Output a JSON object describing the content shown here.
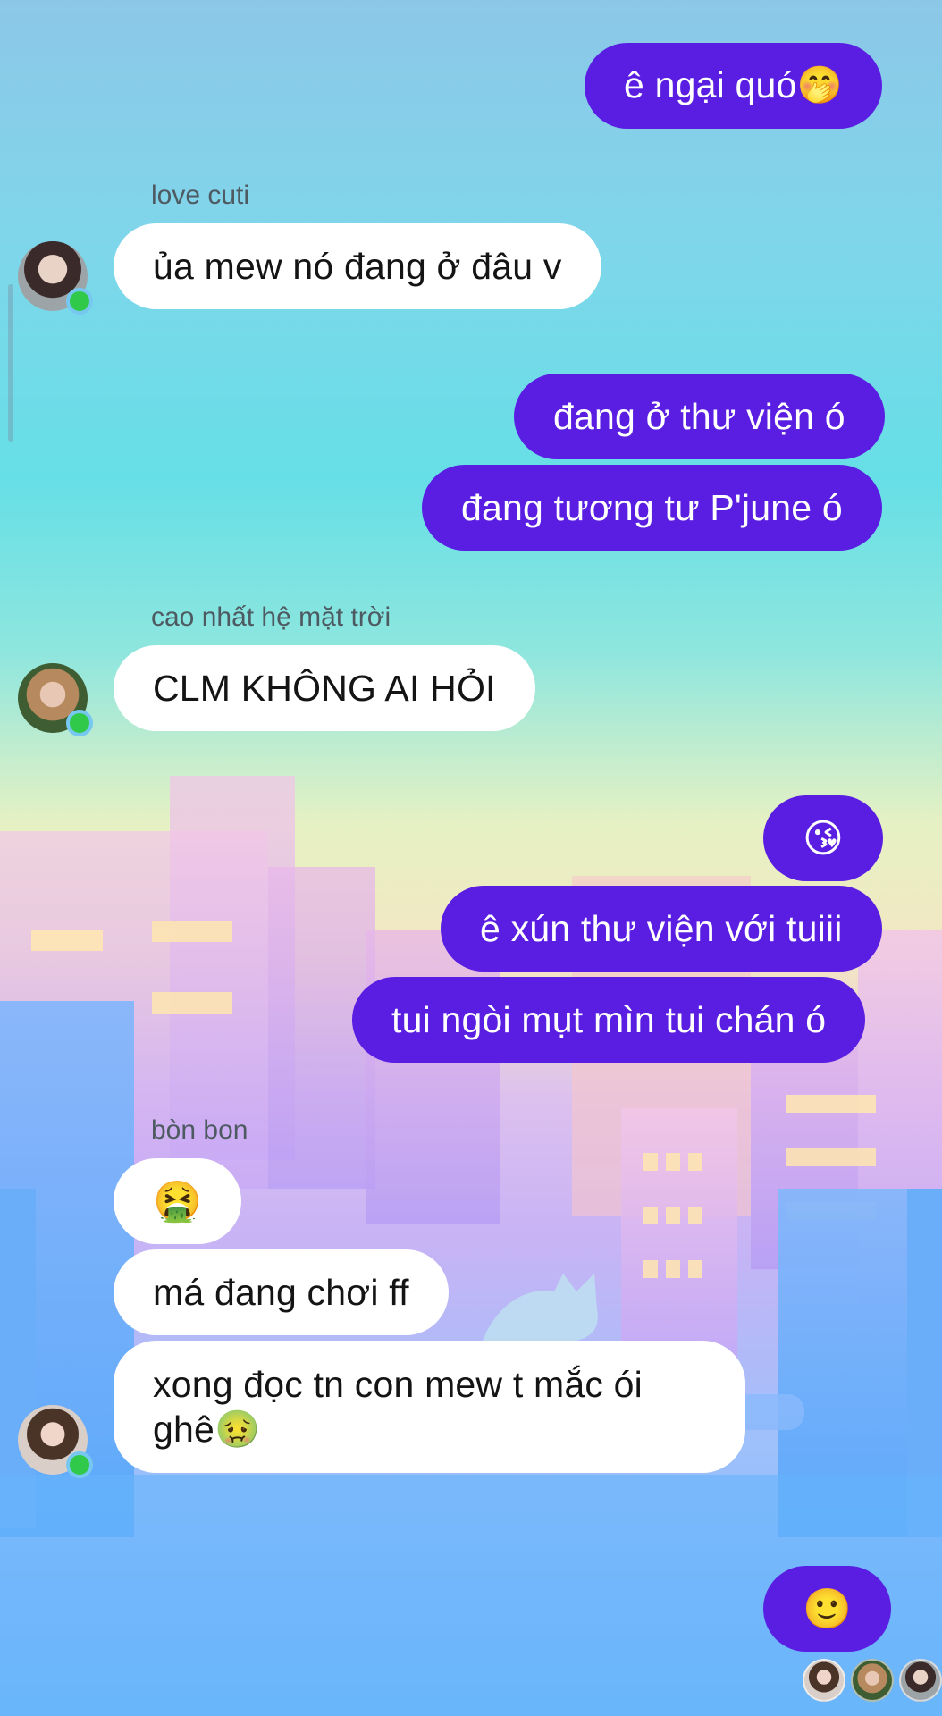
{
  "messages": [
    {
      "text": "ê ngại quó🤭"
    },
    {
      "sender": "love cuti",
      "text": "ủa mew nó đang ở đâu v"
    },
    {
      "text": "đang ở thư viện ó"
    },
    {
      "text": "đang tương tư P'june ó"
    },
    {
      "sender": "cao nhất hệ mặt trời",
      "text": "CLM KHÔNG AI HỎI"
    },
    {
      "text": "😘"
    },
    {
      "text": "ê xún thư viện với tuiii"
    },
    {
      "text": "tui ngòi mụt mìn tui chán ó"
    },
    {
      "sender": "bòn bon",
      "text": "🤮"
    },
    {
      "text": "má đang chơi ff"
    },
    {
      "text": "xong đọc tn con mew t mắc ói ghê🤢"
    },
    {
      "text": "🙂"
    }
  ],
  "colors": {
    "outgoing": "#5a1ee3",
    "incoming": "#ffffff",
    "online": "#31c94a"
  }
}
